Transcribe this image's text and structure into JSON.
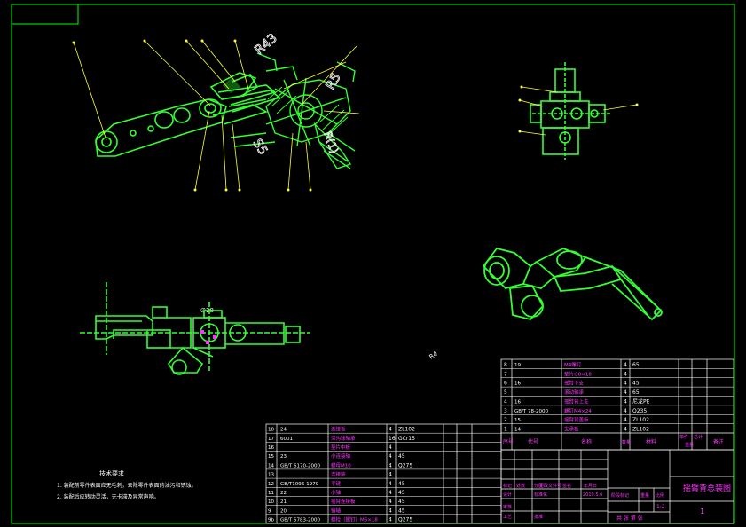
{
  "drawing": {
    "title": "摇臂背总装图",
    "sheet_number": "1",
    "scale": "1:2",
    "scale_label": "比例",
    "weight_label": "重量",
    "stage_label": "阶段标记",
    "sheet_label": "共 张 第 张",
    "design_label": "设计",
    "check_label": "审核",
    "process_label": "工艺",
    "approve_label": "批准",
    "standardize_label": "标准化",
    "date_label": "年月日",
    "sign_label": "签名",
    "change_doc_label": "更改文件号",
    "zone_label": "分区",
    "count_label": "处数",
    "mark_label": "标记",
    "date_value": "2019.5.6"
  },
  "tech_requirements": {
    "heading": "技术要求",
    "items": [
      "1. 装配前零件表面应无毛刺，去除零件表面的油污和锈蚀。",
      "2. 装配后应转动灵活，无卡滞及异常声响。"
    ]
  },
  "view_labels": {
    "dim1": "R43",
    "dim2": "R5",
    "dim3": "S5",
    "dim4": "R(1)",
    "dim5": "∅28",
    "dim6": "∅",
    "dim7": "R4"
  },
  "bom_upper": {
    "rows": [
      {
        "no": "8",
        "code": "19",
        "name": "M4螺钉",
        "qty": "4",
        "material": "65",
        "note": ""
      },
      {
        "no": "7",
        "code": "",
        "name": "垫片∅8×18",
        "qty": "4",
        "material": "",
        "note": ""
      },
      {
        "no": "6",
        "code": "16",
        "name": "摇臂下支",
        "qty": "4",
        "material": "45",
        "note": ""
      },
      {
        "no": "5",
        "code": "",
        "name": "滚动轴承",
        "qty": "4",
        "material": "65",
        "note": ""
      },
      {
        "no": "4",
        "code": "16",
        "name": "摇臂背上支",
        "qty": "4",
        "material": "尼龙PE",
        "note": ""
      },
      {
        "no": "3",
        "code": "GB/T 78-2000",
        "name": "螺钉M4×24",
        "qty": "4",
        "material": "Q235",
        "note": ""
      },
      {
        "no": "2",
        "code": "15",
        "name": "摇臂背盖板",
        "qty": "4",
        "material": "ZL102",
        "note": ""
      },
      {
        "no": "1",
        "code": "14",
        "name": "支承板",
        "qty": "4",
        "material": "ZL102",
        "note": ""
      }
    ],
    "header": {
      "no": "序号",
      "code": "代号",
      "name": "名称",
      "qty": "数量",
      "material": "材料",
      "single": "单件",
      "total": "总计",
      "weight": "重量",
      "note": "备注"
    }
  },
  "bom_lower": {
    "rows": [
      {
        "no": "18",
        "code": "24",
        "name": "连接板",
        "qty": "4",
        "material": "ZL102"
      },
      {
        "no": "17",
        "code": "6001",
        "name": "深沟球轴承",
        "qty": "16",
        "material": "GCr15"
      },
      {
        "no": "16",
        "code": "",
        "name": "垫片中板",
        "qty": "4",
        "material": ""
      },
      {
        "no": "15",
        "code": "23",
        "name": "小连接轴",
        "qty": "4",
        "material": "45"
      },
      {
        "no": "14",
        "code": "GB/T 6170-2000",
        "name": "螺母M10",
        "qty": "4",
        "material": "Q275"
      },
      {
        "no": "13",
        "code": "",
        "name": "连接轴",
        "qty": "4",
        "material": ""
      },
      {
        "no": "12",
        "code": "GB/T1096-1979",
        "name": "平键",
        "qty": "4",
        "material": "45"
      },
      {
        "no": "11",
        "code": "22",
        "name": "小轴",
        "qty": "4",
        "material": "45"
      },
      {
        "no": "10",
        "code": "21",
        "name": "摇臂连接板",
        "qty": "4",
        "material": "45"
      },
      {
        "no": "9",
        "code": "20",
        "name": "销轴",
        "qty": "4",
        "material": "45"
      },
      {
        "no": "9b",
        "code": "GB/T 5783-2000",
        "name": "螺栓（螺钉）M6×18",
        "qty": "4",
        "material": "Q275"
      }
    ]
  },
  "colors": {
    "border": "#00ff00",
    "geometry": "#33ff33",
    "leader": "#ffff00",
    "dimension": "#ffffff",
    "magenta_text": "#ff33ff"
  }
}
